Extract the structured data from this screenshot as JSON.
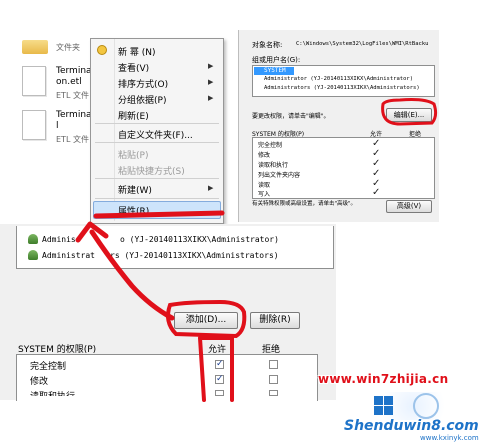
{
  "explorer": {
    "folder_type": "文件夹",
    "files": [
      {
        "name_line1": "Terminal",
        "name_line2": "on.etl",
        "type": "ETL 文件"
      },
      {
        "name_line1": "Terminal",
        "name_line2": "l",
        "type": "ETL 文件"
      }
    ]
  },
  "context_menu": {
    "items": [
      {
        "label": "新 幂 (N)",
        "has_icon": true
      },
      {
        "label": "查看(V)",
        "submenu": true
      },
      {
        "label": "排序方式(O)",
        "submenu": true
      },
      {
        "label": "分组依据(P)",
        "submenu": true
      },
      {
        "label": "刷新(E)"
      },
      {
        "label": "自定义文件夹(F)..."
      },
      {
        "label": "粘贴(P)",
        "disabled": true
      },
      {
        "label": "粘贴快捷方式(S)",
        "disabled": true
      },
      {
        "label": "新建(W)",
        "submenu": true
      },
      {
        "label": "属性(R)",
        "highlighted": true
      }
    ]
  },
  "small_dialog": {
    "object_label": "对象名称:",
    "object_path": "C:\\Windows\\System32\\LogFiles\\WMI\\RtBacku",
    "group_label": "组或用户名(G):",
    "users": [
      "SYSTEM",
      "Administrator (YJ-20140113XIKX\\Administrator)",
      "Administrators (YJ-20140113XIKX\\Administrators)"
    ],
    "edit_hint": "要更改权限，请单击\"编辑\"。",
    "edit_button": "编辑(E)...",
    "perm_header": "SYSTEM 的权限(P)",
    "allow_label": "允许",
    "deny_label": "拒绝",
    "permissions": [
      "完全控制",
      "修改",
      "读取和执行",
      "列出文件夹内容",
      "读取",
      "写入"
    ],
    "advanced_hint": "有关特殊权限或高级设置，请单击\"高级\"。",
    "advanced_button": "高级(V)"
  },
  "large_dialog": {
    "users": [
      {
        "prefix": "Adminis",
        "suffix": "o (YJ-20140113XIKX\\Administrator)"
      },
      {
        "prefix": "Administrat",
        "suffix": "rs (YJ-20140113XIKX\\Administrators)"
      }
    ],
    "add_button": "添加(D)...",
    "remove_button": "删除(R)",
    "perm_header": "SYSTEM 的权限(P)",
    "allow_label": "允许",
    "deny_label": "拒绝",
    "permissions": [
      "完全控制",
      "修改",
      "读取和执行"
    ]
  },
  "watermarks": {
    "site_url": "www.win7zhijia.cn",
    "logo_text": "Shenduwin8.com",
    "sub_url": "www.kxinyk.com"
  },
  "colors": {
    "annotation_red": "#e0101a",
    "menu_highlight": "#cde4fb",
    "dialog_bg": "#f0f0f0",
    "selection_blue": "#3399ff",
    "watermark_blue": "#1e73c8"
  }
}
